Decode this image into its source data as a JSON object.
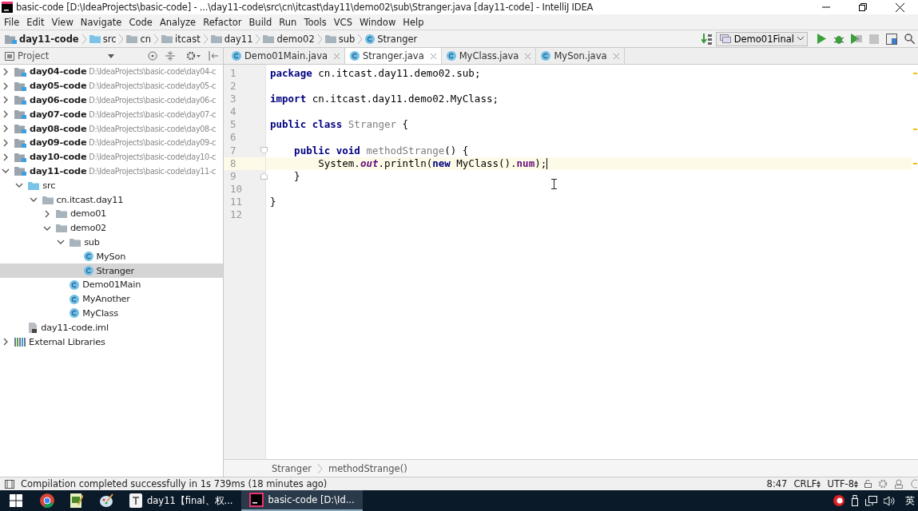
{
  "window": {
    "title": "basic-code [D:\\IdeaProjects\\basic-code] - ...\\day11-code\\src\\cn\\itcast\\day11\\demo02\\sub\\Stranger.java [day11-code] - IntelliJ IDEA"
  },
  "menu": [
    "File",
    "Edit",
    "View",
    "Navigate",
    "Code",
    "Analyze",
    "Refactor",
    "Build",
    "Run",
    "Tools",
    "VCS",
    "Window",
    "Help"
  ],
  "breadcrumbs": [
    {
      "label": "day11-code",
      "kind": "module"
    },
    {
      "label": "src",
      "kind": "source"
    },
    {
      "label": "cn",
      "kind": "package"
    },
    {
      "label": "itcast",
      "kind": "package"
    },
    {
      "label": "day11",
      "kind": "package"
    },
    {
      "label": "demo02",
      "kind": "package"
    },
    {
      "label": "sub",
      "kind": "package"
    },
    {
      "label": "Stranger",
      "kind": "class"
    }
  ],
  "run_config": "Demo01Final",
  "project_panel": {
    "title": "Project"
  },
  "tree": [
    {
      "label": "day04-code",
      "path": "D:\\IdeaProjects\\basic-code\\day04-c",
      "kind": "module",
      "expanded": false,
      "selected": false
    },
    {
      "label": "day05-code",
      "path": "D:\\IdeaProjects\\basic-code\\day05-c",
      "kind": "module",
      "expanded": false,
      "selected": false
    },
    {
      "label": "day06-code",
      "path": "D:\\IdeaProjects\\basic-code\\day06-c",
      "kind": "module",
      "expanded": false,
      "selected": false
    },
    {
      "label": "day07-code",
      "path": "D:\\IdeaProjects\\basic-code\\day07-c",
      "kind": "module",
      "expanded": false,
      "selected": false
    },
    {
      "label": "day08-code",
      "path": "D:\\IdeaProjects\\basic-code\\day08-c",
      "kind": "module",
      "expanded": false,
      "selected": false
    },
    {
      "label": "day09-code",
      "path": "D:\\IdeaProjects\\basic-code\\day09-c",
      "kind": "module",
      "expanded": false,
      "selected": false
    },
    {
      "label": "day10-code",
      "path": "D:\\IdeaProjects\\basic-code\\day10-c",
      "kind": "module",
      "expanded": false,
      "selected": false
    },
    {
      "label": "day11-code",
      "path": "D:\\IdeaProjects\\basic-code\\day11-c",
      "kind": "module",
      "expanded": true,
      "selected": false,
      "children": [
        {
          "label": "src",
          "kind": "source",
          "expanded": true,
          "selected": false,
          "children": [
            {
              "label": "cn.itcast.day11",
              "kind": "package",
              "expanded": true,
              "selected": false,
              "children": [
                {
                  "label": "demo01",
                  "kind": "package",
                  "expanded": false,
                  "selected": false
                },
                {
                  "label": "demo02",
                  "kind": "package",
                  "expanded": true,
                  "selected": false,
                  "children": [
                    {
                      "label": "sub",
                      "kind": "package",
                      "expanded": true,
                      "selected": false,
                      "children": [
                        {
                          "label": "MySon",
                          "kind": "class",
                          "selected": false
                        },
                        {
                          "label": "Stranger",
                          "kind": "class",
                          "selected": true
                        }
                      ]
                    },
                    {
                      "label": "Demo01Main",
                      "kind": "class",
                      "selected": false
                    },
                    {
                      "label": "MyAnother",
                      "kind": "class",
                      "selected": false
                    },
                    {
                      "label": "MyClass",
                      "kind": "class",
                      "selected": false
                    }
                  ]
                }
              ]
            }
          ]
        },
        {
          "label": "day11-code.iml",
          "kind": "file",
          "selected": false
        }
      ]
    },
    {
      "label": "External Libraries",
      "kind": "library",
      "expanded": false,
      "selected": false
    }
  ],
  "tabs": [
    {
      "label": "Demo01Main.java",
      "selected": false
    },
    {
      "label": "Stranger.java",
      "selected": true
    },
    {
      "label": "MyClass.java",
      "selected": false
    },
    {
      "label": "MySon.java",
      "selected": false
    }
  ],
  "code": [
    {
      "number": "1",
      "current": false,
      "tokens": [
        {
          "text": "package",
          "kind": "keyword"
        },
        {
          "text": " cn.itcast.day11.demo02.sub;",
          "kind": "plain"
        }
      ]
    },
    {
      "number": "2",
      "current": false
    },
    {
      "number": "3",
      "current": false,
      "tokens": [
        {
          "text": "import",
          "kind": "keyword"
        },
        {
          "text": " cn.itcast.day11.demo02.MyClass;",
          "kind": "plain"
        }
      ]
    },
    {
      "number": "4",
      "current": false
    },
    {
      "number": "5",
      "current": false,
      "tokens": [
        {
          "text": "public class ",
          "kind": "keyword"
        },
        {
          "text": "Stranger",
          "kind": "unused"
        },
        {
          "text": " {",
          "kind": "plain"
        }
      ]
    },
    {
      "number": "6",
      "current": false
    },
    {
      "number": "7",
      "current": false,
      "fold_start": true,
      "tokens": [
        {
          "text": "    public void ",
          "kind": "keyword"
        },
        {
          "text": "methodStrange",
          "kind": "unused"
        },
        {
          "text": "() {",
          "kind": "plain"
        }
      ]
    },
    {
      "number": "8",
      "current": true,
      "tokens": [
        {
          "text": "        System.",
          "kind": "plain"
        },
        {
          "text": "out",
          "kind": "static"
        },
        {
          "text": ".println(",
          "kind": "plain"
        },
        {
          "text": "new",
          "kind": "keyword"
        },
        {
          "text": " MyClass().",
          "kind": "plain"
        },
        {
          "text": "num",
          "kind": "field"
        },
        {
          "text": ");",
          "kind": "plain"
        }
      ]
    },
    {
      "number": "9",
      "current": false,
      "fold_end": true,
      "tokens": [
        {
          "text": "    }",
          "kind": "plain"
        }
      ]
    },
    {
      "number": "10",
      "current": false
    },
    {
      "number": "11",
      "current": false,
      "tokens": [
        {
          "text": "}",
          "kind": "plain"
        }
      ]
    },
    {
      "number": "12",
      "current": false
    }
  ],
  "editor_breadcrumbs": [
    "Stranger",
    "methodStrange()"
  ],
  "status_bar": {
    "message": "Compilation completed successfully in 1s 739ms (18 minutes ago)",
    "position": "8:47",
    "line_separator": "CRLF",
    "encoding": "UTF-8"
  },
  "taskbar": {
    "items": [
      {
        "kind": "browser",
        "selected": false
      },
      {
        "kind": "editor",
        "selected": false
      },
      {
        "kind": "paint",
        "selected": false
      },
      {
        "kind": "text",
        "label": "day11【final、权...",
        "selected": false
      },
      {
        "kind": "ide",
        "label": "basic-code [D:\\Id...",
        "selected": true
      }
    ],
    "input_method": "英"
  }
}
